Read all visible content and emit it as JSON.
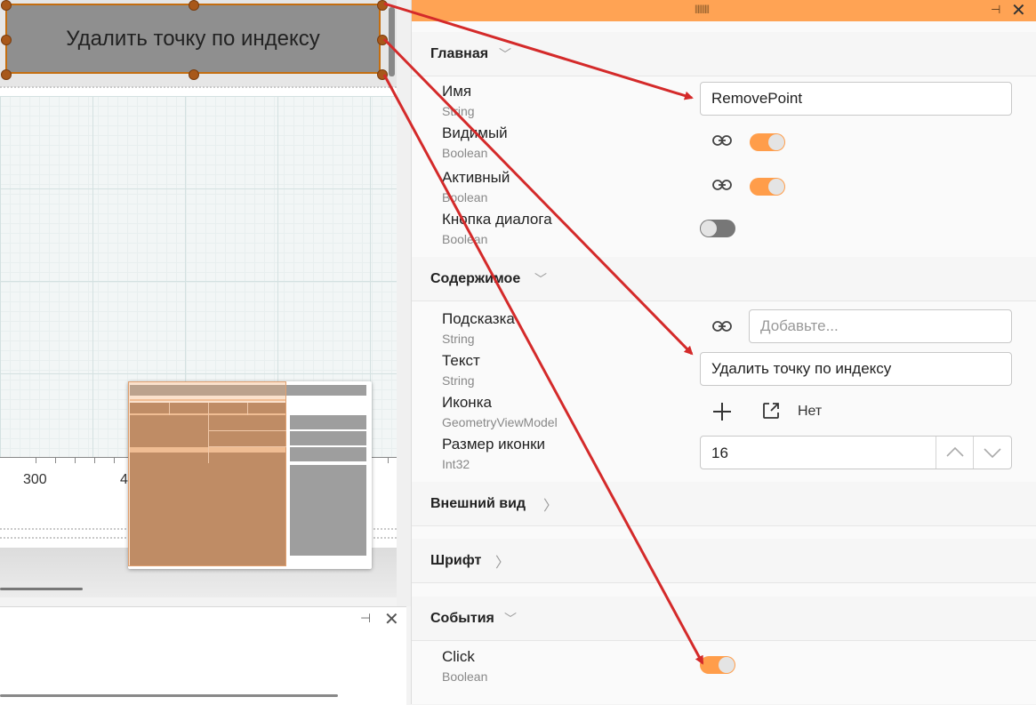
{
  "canvas": {
    "selected_button_label": "Удалить точку по индексу",
    "ruler_labels": [
      "300",
      "4"
    ]
  },
  "props": {
    "sections": {
      "main": "Главная",
      "content": "Содержимое",
      "appearance": "Внешний вид",
      "font": "Шрифт",
      "events": "События"
    },
    "name": {
      "label": "Имя",
      "type": "String",
      "value": "RemovePoint"
    },
    "visible": {
      "label": "Видимый",
      "type": "Boolean",
      "state": true
    },
    "active": {
      "label": "Активный",
      "type": "Boolean",
      "state": true
    },
    "dialog_button": {
      "label": "Кнопка диалога",
      "type": "Boolean",
      "state": false
    },
    "tooltip": {
      "label": "Подсказка",
      "type": "String",
      "placeholder": "Добавьте..."
    },
    "text": {
      "label": "Текст",
      "type": "String",
      "value": "Удалить точку по индексу"
    },
    "icon": {
      "label": "Иконка",
      "type": "GeometryViewModel",
      "value": "Нет"
    },
    "icon_size": {
      "label": "Размер иконки",
      "type": "Int32",
      "value": "16"
    },
    "click": {
      "label": "Click",
      "type": "Boolean",
      "state": true
    }
  },
  "colors": {
    "accent": "#ffa354",
    "toggle_on": "#ff9d4a",
    "arrow": "#d42a2a",
    "selection": "#c46e10"
  }
}
